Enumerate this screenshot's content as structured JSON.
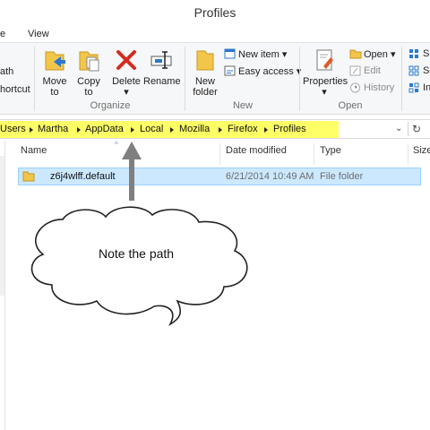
{
  "window": {
    "title": "Profiles"
  },
  "menu": {
    "tab_left": "e",
    "tab_view": "View"
  },
  "ribbon": {
    "partial_top": "ath",
    "partial_bottom": "hortcut",
    "move_to": "Move to",
    "move_to_1": "Move",
    "move_to_2": "to",
    "copy_to_1": "Copy",
    "copy_to_2": "to",
    "delete_1": "Delete",
    "delete_2": "▾",
    "rename": "Rename",
    "organize_label": "Organize",
    "new_folder_1": "New",
    "new_folder_2": "folder",
    "new_item": "New item ▾",
    "easy_access": "Easy access ▾",
    "new_label": "New",
    "properties_1": "Properties",
    "properties_2": "▾",
    "open": "Open ▾",
    "edit": "Edit",
    "history": "History",
    "open_label": "Open",
    "sel_1": "Se",
    "sel_2": "Se",
    "sel_3": "In"
  },
  "address": {
    "crumbs": [
      "Users",
      "Martha",
      "AppData",
      "Local",
      "Mozilla",
      "Firefox",
      "Profiles"
    ],
    "dropdown_glyph": "⌄",
    "refresh_glyph": "↻"
  },
  "columns": {
    "name": "Name",
    "date": "Date modified",
    "type": "Type",
    "size": "Size"
  },
  "rows": [
    {
      "name": "z6j4wlff.default",
      "date": "6/21/2014 10:49 AM",
      "type": "File folder"
    }
  ],
  "callout": {
    "text": "Note the path"
  },
  "colors": {
    "highlight": "#ffff66",
    "selection": "#cce8ff",
    "arrow": "#7f7f7f"
  }
}
